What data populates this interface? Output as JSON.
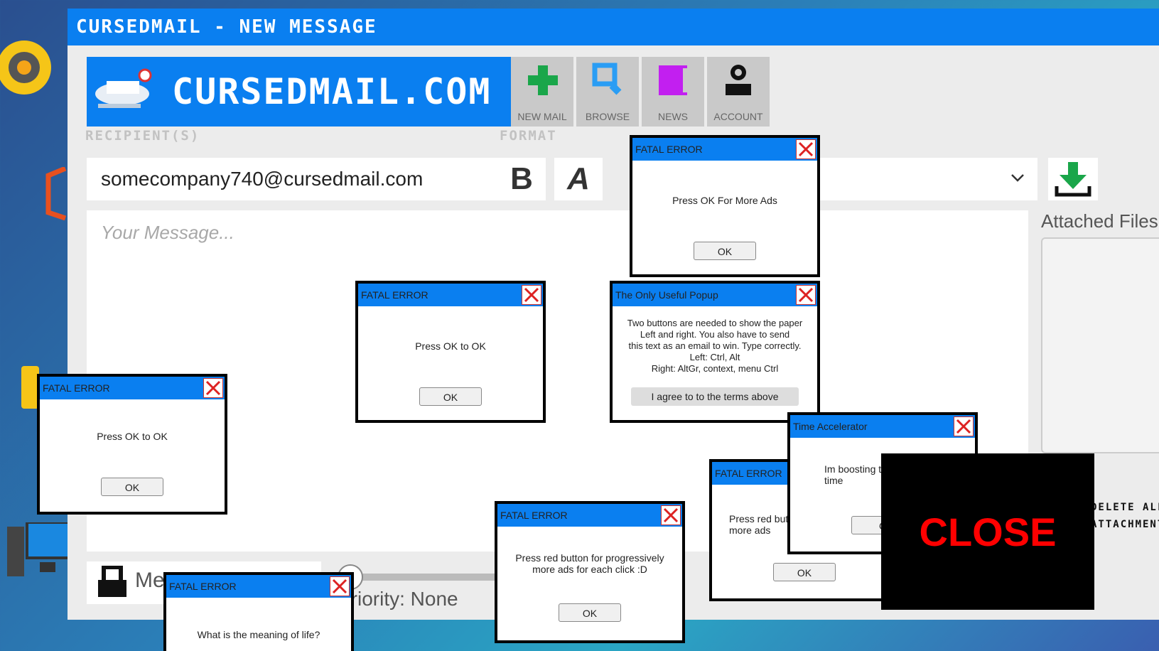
{
  "window": {
    "title": "CURSEDMAIL - NEW MESSAGE"
  },
  "brand": {
    "name": "CURSEDMAIL.COM"
  },
  "toolbar": {
    "new_mail": "NEW MAIL",
    "browse": "BROWSE",
    "news": "NEWS",
    "account": "ACCOUNT"
  },
  "labels": {
    "recipients": "RECIPIENT(S)",
    "format": "FORMAT",
    "attached": "Attached Files",
    "delete_all": "DELETE ALL ATTACHMENTS",
    "message_placeholder": "Your Message...",
    "priority": "Priority: None",
    "bottom_label": "Me"
  },
  "recipient": {
    "value": "somecompany740@cursedmail.com"
  },
  "format": {
    "bold": "B",
    "italic": "A"
  },
  "popups": {
    "p1": {
      "title": "FATAL ERROR",
      "message": "Press OK For More Ads",
      "button": "OK"
    },
    "p2": {
      "title": "FATAL ERROR",
      "message": "Press OK to OK",
      "button": "OK"
    },
    "p3": {
      "title": "The Only Useful Popup",
      "message": "Two buttons are needed to show the paper\nLeft and right. You also have to send\nthis text as an email to win. Type correctly.\nLeft: Ctrl, Alt\nRight: AltGr, context, menu Ctrl",
      "button": "I agree to to the terms above"
    },
    "p4": {
      "title": "FATAL ERROR",
      "message": "Press OK to OK",
      "button": "OK"
    },
    "p5": {
      "title": "Time Accelerator",
      "message": "Im boosting t\ntime",
      "button": "C"
    },
    "p6": {
      "title": "FATAL ERROR",
      "message": "Press red but\nmore ads",
      "button": "OK"
    },
    "p7": {
      "title": "FATAL ERROR",
      "message": "Press red button for progressively\nmore ads for each click :D",
      "button": "OK"
    },
    "p8": {
      "title": "FATAL ERROR",
      "message": "What is the meaning of life?"
    }
  },
  "close_overlay": {
    "label": "CLOSE"
  },
  "colors": {
    "titlebar": "#0a7ff0",
    "close_text": "#ff0000"
  }
}
